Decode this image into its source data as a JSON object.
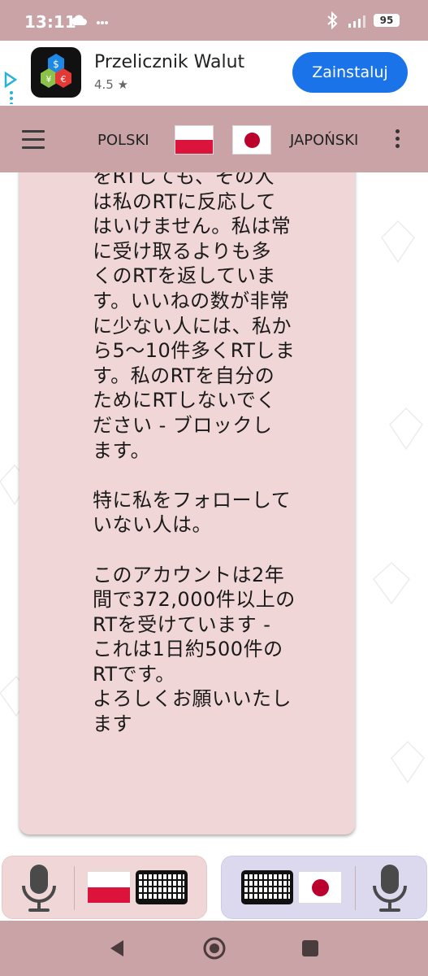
{
  "status_bar": {
    "time": "13:11",
    "battery": "95",
    "icons": [
      "cloud-icon",
      "more-dots-icon",
      "bluetooth-icon",
      "signal-icon",
      "battery-icon"
    ]
  },
  "ad": {
    "app_name": "Przelicznik Walut",
    "rating": "4.5 ★",
    "install_label": "Zainstaluj",
    "icons": [
      "ad-choices-icon",
      "currency-app-icon"
    ]
  },
  "toolbar": {
    "source_lang": "POLSKI",
    "target_lang": "JAPOŃSKI",
    "icons": [
      "menu-icon",
      "flag-poland-icon",
      "flag-japan-icon",
      "more-vert-icon"
    ]
  },
  "message": {
    "text": "をRTしても、その人\nは私のRTに反応して\nはいけません。私は常\nに受け取るよりも多\nくのRTを返していま\nす。いいねの数が非常\nに少ない人には、私か\nら5〜10件多くRTしま\nす。私のRTを自分の\nためにRTしないでく\nださい - ブロックし\nます。\n\n特に私をフォローして\nいない人は。\n\nこのアカウントは2年\n間で372,000件以上の\nRTを受けています -\nこれは1日約500件の\nRTです。\nよろしくお願いいたし\nます"
  },
  "controls": {
    "left": [
      "microphone-icon",
      "flag-poland-icon",
      "keyboard-icon"
    ],
    "right": [
      "keyboard-icon",
      "flag-japan-icon",
      "microphone-icon"
    ]
  },
  "navbar": [
    "back-icon",
    "home-icon",
    "recents-icon"
  ],
  "colors": {
    "bar": "#c9a3a5",
    "bubble": "#f0d6d7",
    "install": "#1a73e8",
    "right_panel": "#dcd8ee"
  }
}
